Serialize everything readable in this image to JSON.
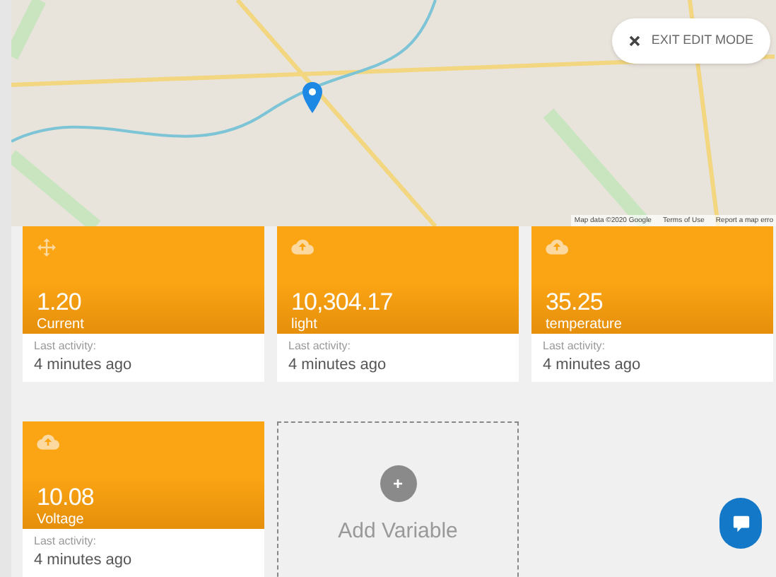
{
  "map": {
    "attribution": [
      "Map data ©2020 Google",
      "Terms of Use",
      "Report a map erro"
    ]
  },
  "exit_button": {
    "label": "EXIT EDIT MODE"
  },
  "cards": [
    {
      "kind": "variable",
      "value": "1.20",
      "name": "Current",
      "activity_label": "Last activity:",
      "activity": "4 minutes ago"
    },
    {
      "kind": "variable",
      "value": "10,304.17",
      "name": "light",
      "activity_label": "Last activity:",
      "activity": "4 minutes ago"
    },
    {
      "kind": "variable",
      "value": "35.25",
      "name": "temperature",
      "activity_label": "Last activity:",
      "activity": "4 minutes ago"
    },
    {
      "kind": "variable",
      "value": "10.08",
      "name": "Voltage",
      "activity_label": "Last activity:",
      "activity": "4 minutes ago"
    },
    {
      "kind": "add",
      "plus": "+",
      "label": "Add Variable"
    }
  ]
}
